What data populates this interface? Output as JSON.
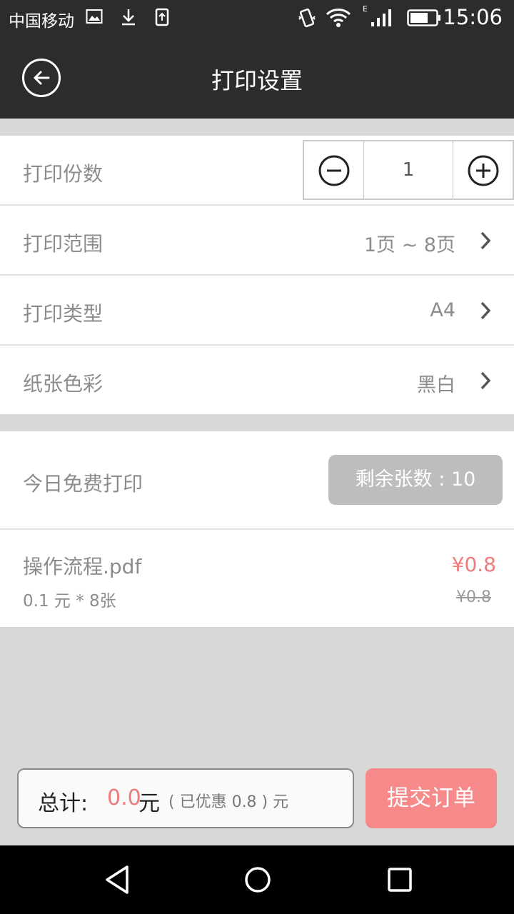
{
  "status_bar": {
    "carrier": "中国移动",
    "network_type": "E",
    "time": "15:06",
    "icons": [
      "image-icon",
      "download-icon",
      "upload-icon",
      "vibrate-icon",
      "wifi-icon",
      "signal-icon",
      "battery-icon"
    ]
  },
  "header": {
    "title": "打印设置",
    "back_icon": "back-arrow-icon"
  },
  "settings": {
    "copies": {
      "label": "打印份数",
      "value": "1"
    },
    "range": {
      "label": "打印范围",
      "value": "1页 ~ 8页"
    },
    "type": {
      "label": "打印类型",
      "value": "A4"
    },
    "color": {
      "label": "纸张色彩",
      "value": "黑白"
    }
  },
  "free_print": {
    "label": "今日免费打印",
    "remaining": "剩余张数 : 10"
  },
  "file": {
    "name": "操作流程.pdf",
    "detail": "0.1 元 * 8张",
    "price": "¥0.8",
    "original_price": "¥0.8"
  },
  "footer": {
    "total_label": "总计:",
    "total_amount": "0.0",
    "total_unit": "元",
    "discount": "( 已优惠 0.8 ) 元",
    "submit_label": "提交订单"
  },
  "colors": {
    "header_bg": "#2c2c2c",
    "accent": "#f07a7a",
    "submit_bg": "#f68a8a",
    "page_bg": "#d8d8d8"
  }
}
